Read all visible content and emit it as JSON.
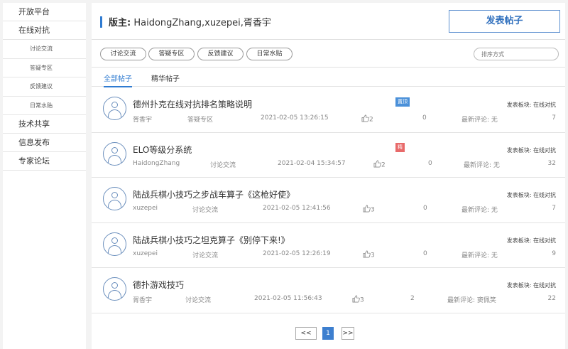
{
  "sidebar": {
    "items": [
      {
        "label": "开放平台",
        "type": "main"
      },
      {
        "label": "在线对抗",
        "type": "main"
      },
      {
        "label": "讨论交流",
        "type": "sub"
      },
      {
        "label": "答疑专区",
        "type": "sub"
      },
      {
        "label": "反馈建议",
        "type": "sub"
      },
      {
        "label": "日常水贴",
        "type": "sub"
      },
      {
        "label": "技术共享",
        "type": "main"
      },
      {
        "label": "信息发布",
        "type": "main"
      },
      {
        "label": "专家论坛",
        "type": "main"
      }
    ]
  },
  "header": {
    "moderator_label": "版主:",
    "moderator_names": "HaidongZhang,xuzepei,胥香宇",
    "post_button": "发表帖子"
  },
  "filters": {
    "pills": [
      "讨论交流",
      "答疑专区",
      "反馈建议",
      "日常水贴"
    ],
    "sort_placeholder": "排序方式"
  },
  "tabs": [
    "全部帖子",
    "精华帖子"
  ],
  "posts": [
    {
      "title": "德州扑克在线对抗排名策略说明",
      "badge": "置顶",
      "badge_color": "#4a90d9",
      "author": "胥香宇",
      "category": "答疑专区",
      "time": "2021-02-05 13:26:15",
      "likes": "2",
      "replies": "0",
      "latest": "最新评论: 无",
      "board": "发表板块: 在线对抗",
      "views": "7"
    },
    {
      "title": "ELO等级分系统",
      "badge": "精",
      "badge_color": "#e86a6a",
      "author": "HaidongZhang",
      "category": "讨论交流",
      "time": "2021-02-04 15:34:57",
      "likes": "2",
      "replies": "0",
      "latest": "最新评论: 无",
      "board": "发表板块: 在线对抗",
      "views": "32"
    },
    {
      "title": "陆战兵棋小技巧之步战车算子《这枪好使》",
      "badge": "",
      "badge_color": "",
      "author": "xuzepei",
      "category": "讨论交流",
      "time": "2021-02-05 12:41:56",
      "likes": "3",
      "replies": "0",
      "latest": "最新评论: 无",
      "board": "发表板块: 在线对抗",
      "views": "7"
    },
    {
      "title": "陆战兵棋小技巧之坦克算子《别停下来!》",
      "badge": "",
      "badge_color": "",
      "author": "xuzepei",
      "category": "讨论交流",
      "time": "2021-02-05 12:26:19",
      "likes": "3",
      "replies": "0",
      "latest": "最新评论: 无",
      "board": "发表板块: 在线对抗",
      "views": "9"
    },
    {
      "title": "德扑游戏技巧",
      "badge": "",
      "badge_color": "",
      "author": "胥香宇",
      "category": "讨论交流",
      "time": "2021-02-05 11:56:43",
      "likes": "3",
      "replies": "2",
      "latest": "最新评论: 窦佩笑",
      "board": "发表板块: 在线对抗",
      "views": "22"
    }
  ],
  "pagination": {
    "prev": "<<",
    "current": "1",
    "next": ">>"
  }
}
